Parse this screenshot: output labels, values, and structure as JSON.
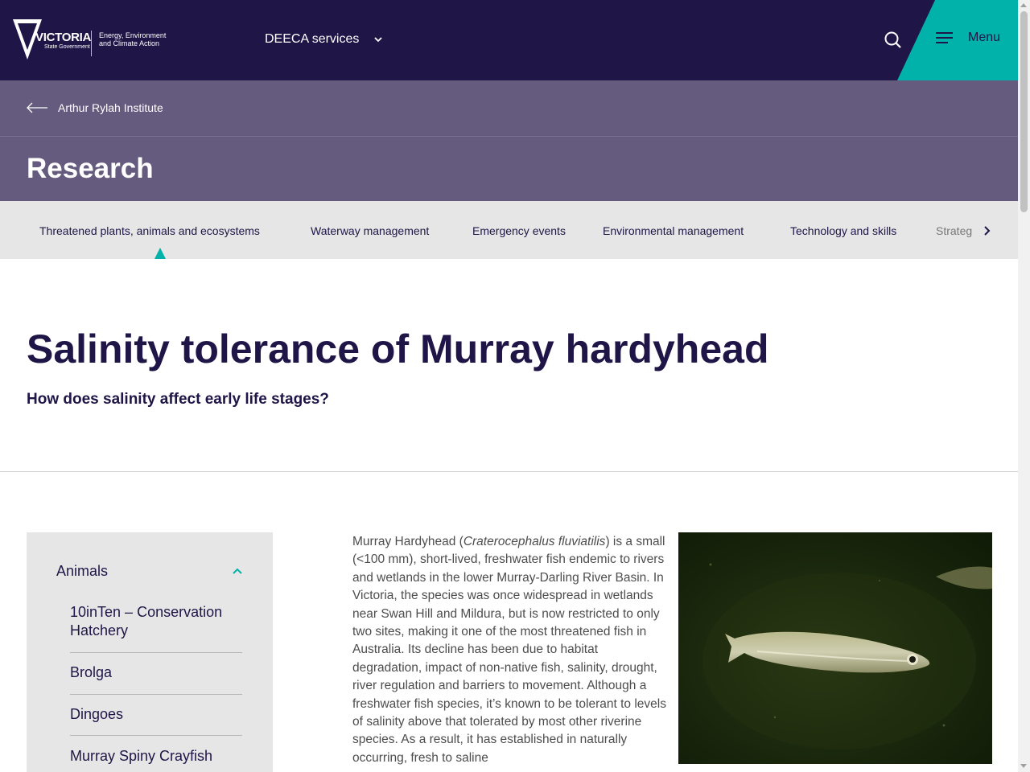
{
  "header": {
    "logo_text": "VICTORIA",
    "logo_sub": "State Government",
    "dept_text": "Energy, Environment and Climate Action",
    "services_label": "DEECA services",
    "menu_label": "Menu"
  },
  "breadcrumb": {
    "label": "Arthur Rylah Institute"
  },
  "section": {
    "title": "Research"
  },
  "tabs": [
    {
      "label": "Threatened plants, animals and ecosystems",
      "active": true
    },
    {
      "label": "Waterway management"
    },
    {
      "label": "Emergency events"
    },
    {
      "label": "Environmental management"
    },
    {
      "label": "Technology and skills"
    },
    {
      "label": "Strateg"
    }
  ],
  "page": {
    "title": "Salinity tolerance of Murray hardyhead",
    "subtitle": "How does salinity affect early life stages?"
  },
  "sidenav": {
    "heading": "Animals",
    "items": [
      {
        "label": "10inTen – Conservation Hatchery"
      },
      {
        "label": "Brolga"
      },
      {
        "label": "Dingoes"
      },
      {
        "label": "Murray Spiny Crayfish"
      }
    ]
  },
  "body": {
    "p1_a": "Murray Hardyhead (",
    "p1_species": "Craterocephalus fluviatilis",
    "p1_b": ") is a small (<100 mm), short-lived, freshwater fish endemic to rivers and wetlands in the lower Murray-Darling River Basin. In Victoria, the species was once widespread in wetlands near Swan Hill and Mildura, but is now restricted to only two sites, making it one of the most threatened fish in Australia. Its decline has been due to habitat degradation, impact of non-native fish, salinity, drought, river regulation and barriers to movement. Although a freshwater fish species, it’s known to be tolerant to levels of salinity above that tolerated by most other riverine species. As a result, it has established in naturally occurring, fresh to saline",
    "image_alt": "Murray hardyhead fish"
  },
  "colors": {
    "navy": "#201547",
    "purple": "#655b7f",
    "teal": "#00b2a9",
    "grey": "#e6e6e6"
  }
}
